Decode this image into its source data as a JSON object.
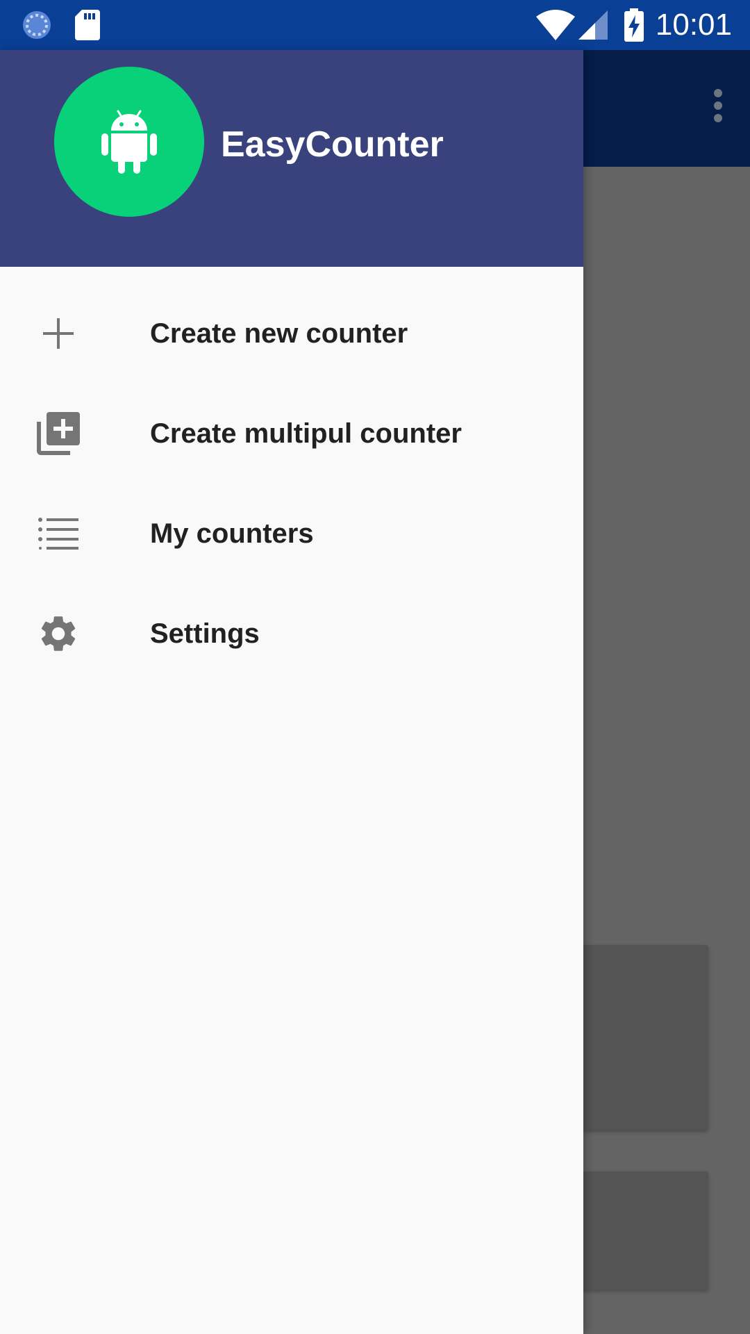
{
  "status_bar": {
    "time": "10:01",
    "icons": [
      "sync-icon",
      "sd-card-icon",
      "wifi-icon",
      "cell-signal-icon",
      "battery-charging-icon"
    ],
    "color": "#0A3F96"
  },
  "drawer": {
    "header": {
      "app_name": "EasyCounter",
      "avatar_icon": "android-icon",
      "header_color": "#39427C",
      "avatar_color": "#08D17A"
    },
    "items": [
      {
        "label": "Create new counter",
        "icon": "plus-icon"
      },
      {
        "label": "Create multipul counter",
        "icon": "library-add-icon"
      },
      {
        "label": "My counters",
        "icon": "list-icon"
      },
      {
        "label": "Settings",
        "icon": "gear-icon"
      }
    ]
  },
  "background_app": {
    "toolbar_icon": "more-vert-icon",
    "scrim_color": "#646464"
  }
}
